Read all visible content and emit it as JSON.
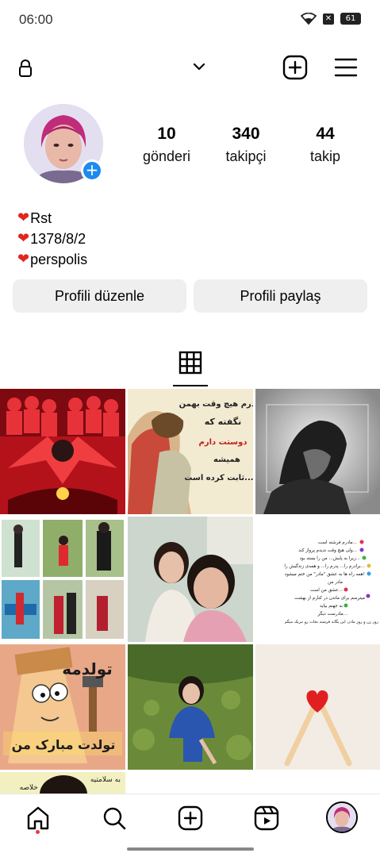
{
  "status_bar": {
    "time": "06:00",
    "battery": "61"
  },
  "profile": {
    "stats": [
      {
        "value": "10",
        "label": "gönderi"
      },
      {
        "value": "340",
        "label": "takipçi"
      },
      {
        "value": "44",
        "label": "takip"
      }
    ],
    "bio": [
      "Rst",
      "1378/8/2",
      "perspolis"
    ],
    "edit_button": "Profili düzenle",
    "share_button": "Profili paylaş"
  },
  "posts": {
    "tile2_text": [
      "پدرم هیچ وقت بهمن",
      "نگفته که",
      "دوستت دارم",
      "همیشه",
      "ثابت کرده است..."
    ],
    "tile6_text": [
      "مادرم فرشته است...",
      "ولی هیچ وقت ندیدم پرواز کند...",
      "زیرا به پایش... من را بسته بود...",
      "برادرم را... پدرم را... و همه‌ی زندگیش را...",
      "همه راه ها به عشق \"مادر\" من ختم میشود!",
      "مادر من",
      "عشق من است...",
      "میترسم برای ماندن در کنارم از بهشت",
      "به جهنم بیاید",
      "مادرست دیگر...",
      "روز زن و روز مادر، این یگانه فرشته نجات رو تبریک میگم"
    ],
    "tile7_text": [
      "تولدمه",
      "تولدت مبارک من"
    ],
    "tile10_text": [
      "به سلامتیه",
      "خلاصه"
    ]
  },
  "colors": {
    "accent": "#1c8af0",
    "heart": "#e0261e",
    "button_bg": "#efefef"
  },
  "icons": [
    "lock-icon",
    "chevron-down-icon",
    "add-icon",
    "menu-icon",
    "grid-icon",
    "home-icon",
    "search-icon",
    "create-icon",
    "reels-icon"
  ]
}
